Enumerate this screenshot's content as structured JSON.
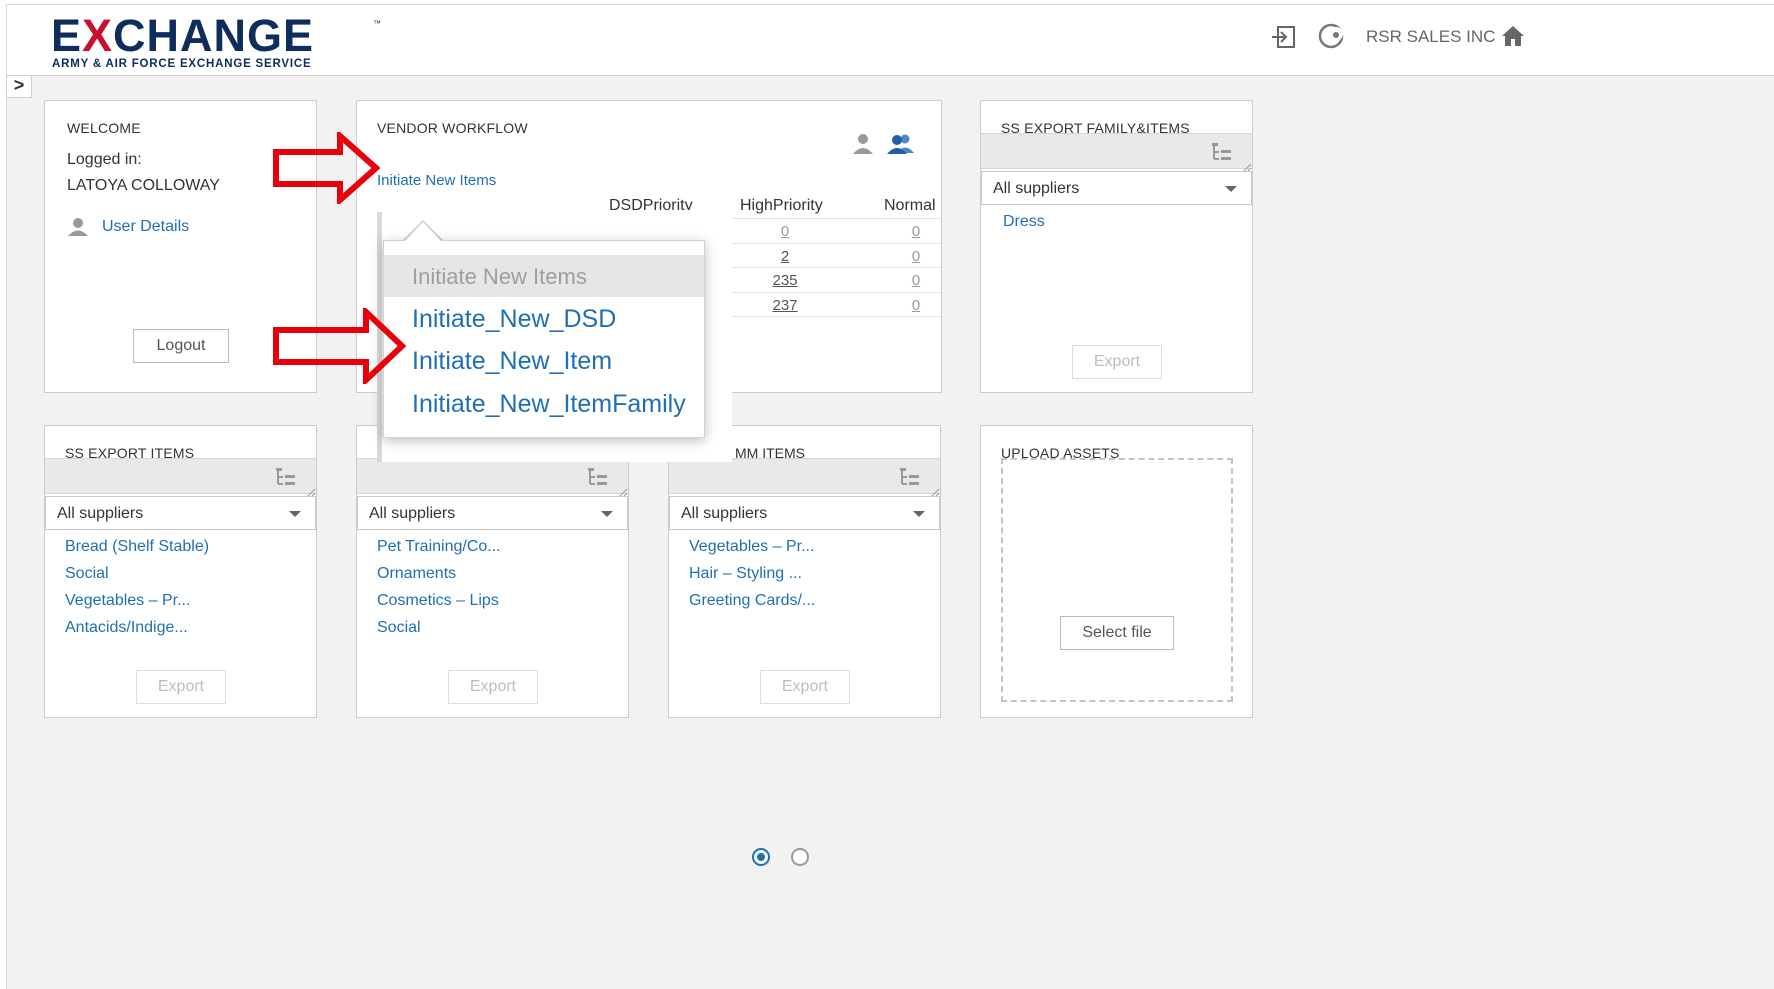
{
  "header": {
    "logo_main_pre": "E",
    "logo_main_x": "X",
    "logo_main_post": "CHANGE",
    "logo_tm": "™",
    "logo_sub": "ARMY & AIR FORCE EXCHANGE SERVICE",
    "company": "RSR SALES INC",
    "icons": [
      "sign-in-icon",
      "moon-icon",
      "home-icon"
    ],
    "toggle_glyph": ">"
  },
  "welcome": {
    "title": "WELCOME",
    "logged_in_label": "Logged in:",
    "user_name": "LATOYA COLLOWAY",
    "user_details_link": "User Details",
    "logout_label": "Logout"
  },
  "vendor_workflow": {
    "title": "VENDOR WORKFLOW",
    "initiate_link": "Initiate New Items",
    "columns": [
      "DSDPriority",
      "HighPriority",
      "Normal"
    ],
    "rows": [
      {
        "high": "0",
        "normal": "0"
      },
      {
        "high": "2",
        "normal": "0"
      },
      {
        "high": "235",
        "normal": "0"
      },
      {
        "high": "237",
        "normal": "0"
      }
    ],
    "popup": {
      "header": "Initiate New Items",
      "items": [
        "Initiate_New_DSD",
        "Initiate_New_Item",
        "Initiate_New_ItemFamily"
      ]
    }
  },
  "ss_export_family": {
    "title": "SS EXPORT FAMILY&ITEMS",
    "dropdown": "All suppliers",
    "items": [
      "Dress"
    ],
    "export_label": "Export"
  },
  "ss_export_items": {
    "title": "SS EXPORT ITEMS",
    "dropdown": "All suppliers",
    "items": [
      "Bread (Shelf Stable)",
      "Social",
      "Vegetables – Pr...",
      "Antacids/Indige..."
    ],
    "export_label": "Export"
  },
  "middle_export": {
    "dropdown": "All suppliers",
    "items": [
      "Pet Training/Co...",
      "Ornaments",
      "Cosmetics – Lips",
      "Social"
    ],
    "export_label": "Export"
  },
  "comm_items": {
    "title_visible": "MM ITEMS",
    "dropdown": "All suppliers",
    "items": [
      "Vegetables – Pr...",
      "Hair – Styling ...",
      "Greeting Cards/..."
    ],
    "export_label": "Export"
  },
  "upload_assets": {
    "title": "UPLOAD ASSETS",
    "select_file_label": "Select file"
  },
  "pagination": {
    "pages": 2,
    "active_page": 1
  },
  "colors": {
    "link": "#1f6fb5",
    "brand_navy": "#0e2c5c",
    "brand_red": "#c8102e",
    "annotation_arrow": "#e8000b"
  }
}
